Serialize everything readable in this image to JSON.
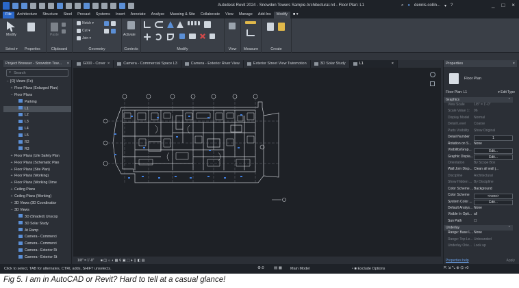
{
  "titlebar": {
    "title": "Autodesk Revit 2024 - Snowdon Towers Sample Architectural.rvt - Floor Plan: L1",
    "user": "dennis.collin...",
    "min": "_",
    "max": "□",
    "close": "×"
  },
  "menu": [
    "File",
    "Architecture",
    "Structure",
    "Steel",
    "Precast",
    "Systems",
    "Insert",
    "Annotate",
    "Analyze",
    "Massing & Site",
    "Collaborate",
    "View",
    "Manage",
    "Add-Ins",
    "Modify"
  ],
  "ribbon": {
    "modify_label": "Modify",
    "select_label": "Select ▾",
    "properties_label": "Properties",
    "clipboard_label": "Clipboard",
    "geometry_label": "Geometry",
    "controls_label": "Controls",
    "modify_group_label": "Modify",
    "view_label": "View",
    "measure_label": "Measure",
    "create_label": "Create",
    "paste_label": "Paste",
    "notch_label": "Notch ▾",
    "cut_label": "Cut ▾",
    "join_label": "Join ▾",
    "activate_label": "Activate"
  },
  "project_browser": {
    "title": "Project Browser - Snowdon Tow...",
    "close": "×",
    "search_placeholder": "Search",
    "items": [
      {
        "t": "−",
        "label": "[O] Views (Fe)",
        "indent": 0
      },
      {
        "t": "+",
        "label": "Floor Plans (Enlarged Plan)",
        "indent": 1
      },
      {
        "t": "−",
        "label": "Floor Plans",
        "indent": 1
      },
      {
        "t": "",
        "label": "Parking",
        "indent": 2,
        "icon": true
      },
      {
        "t": "",
        "label": "L1",
        "indent": 2,
        "icon": true,
        "sel": true
      },
      {
        "t": "",
        "label": "L2",
        "indent": 2,
        "icon": true
      },
      {
        "t": "",
        "label": "L3",
        "indent": 2,
        "icon": true
      },
      {
        "t": "",
        "label": "L4",
        "indent": 2,
        "icon": true
      },
      {
        "t": "",
        "label": "L5",
        "indent": 2,
        "icon": true
      },
      {
        "t": "",
        "label": "R2",
        "indent": 2,
        "icon": true
      },
      {
        "t": "",
        "label": "R3",
        "indent": 2,
        "icon": true
      },
      {
        "t": "+",
        "label": "Floor Plans (Life Safety Plan",
        "indent": 1
      },
      {
        "t": "+",
        "label": "Floor Plans (Schematic Plan",
        "indent": 1
      },
      {
        "t": "+",
        "label": "Floor Plans (Site Plan)",
        "indent": 1
      },
      {
        "t": "+",
        "label": "Floor Plans (Working)",
        "indent": 1
      },
      {
        "t": "+",
        "label": "Floor Plans (Working Dime",
        "indent": 1
      },
      {
        "t": "+",
        "label": "Ceiling Plans",
        "indent": 1
      },
      {
        "t": "+",
        "label": "Ceiling Plans (Working)",
        "indent": 1
      },
      {
        "t": "+",
        "label": "3D Views (3D Coordinatior",
        "indent": 1
      },
      {
        "t": "−",
        "label": "3D Views",
        "indent": 1
      },
      {
        "t": "",
        "label": "3D (Shaded) Unscop",
        "indent": 2,
        "icon": true
      },
      {
        "t": "",
        "label": "3D Solar Study",
        "indent": 2,
        "icon": true
      },
      {
        "t": "",
        "label": "At Ramp",
        "indent": 2,
        "icon": true
      },
      {
        "t": "",
        "label": "Camera - Commerci",
        "indent": 2,
        "icon": true
      },
      {
        "t": "",
        "label": "Camera - Commerci",
        "indent": 2,
        "icon": true
      },
      {
        "t": "",
        "label": "Camera - Exterior Ri",
        "indent": 2,
        "icon": true
      },
      {
        "t": "",
        "label": "Camera - Exterior St",
        "indent": 2,
        "icon": true
      }
    ]
  },
  "tabs": [
    "G000 - Cover",
    "Camera - Commercial Space L3",
    "Camera - Exterior River View",
    "Exterior Street View Twinmotion",
    "3D Solar Study",
    "L1"
  ],
  "view_control": {
    "scale": "1/8\" = 1'-0\""
  },
  "properties": {
    "title": "Properties",
    "close": "×",
    "type": "Floor Plan",
    "instance": "Floor Plan: L1",
    "edit_type": "Edit Type",
    "graphics_label": "Graphics",
    "underlay_label": "Underlay",
    "graphics": [
      {
        "k": "View Scale",
        "v": "1/8\" = 1'-0\"",
        "dim": true
      },
      {
        "k": "Scale Value  1:",
        "v": "96",
        "dim": true
      },
      {
        "k": "Display Model",
        "v": "Normal",
        "dim": true
      },
      {
        "k": "Detail Level",
        "v": "Coarse",
        "dim": true
      },
      {
        "k": "Parts Visibility",
        "v": "Show Original",
        "dim": true
      },
      {
        "k": "Detail Number",
        "v": "1",
        "box": true
      },
      {
        "k": "Rotation on S...",
        "v": "None"
      },
      {
        "k": "Visibility/Grap...",
        "v": "Edit...",
        "box": true
      },
      {
        "k": "Graphic Displa...",
        "v": "Edit...",
        "box": true
      },
      {
        "k": "Orientation",
        "v": "By Scope Box",
        "dim": true
      },
      {
        "k": "Wall Join Disp...",
        "v": "Clean all wall j..."
      },
      {
        "k": "Discipline",
        "v": "Architectural",
        "dim": true
      },
      {
        "k": "Show Hidden ...",
        "v": "By Discipline",
        "dim": true
      },
      {
        "k": "Color Scheme ...",
        "v": "Background"
      },
      {
        "k": "Color Scheme",
        "v": "<none>",
        "box": true
      },
      {
        "k": "System Color ...",
        "v": "Edit...",
        "box": true
      },
      {
        "k": "Default Analys...",
        "v": "None"
      },
      {
        "k": "Visible In Opti...",
        "v": "all"
      },
      {
        "k": "Sun Path",
        "v": "☐"
      }
    ],
    "underlay": [
      {
        "k": "Range: Base L...",
        "v": "None"
      },
      {
        "k": "Range: Top Le...",
        "v": "Unbounded",
        "dim": true
      },
      {
        "k": "Underlay Orie...",
        "v": "Look up",
        "dim": true
      }
    ],
    "help": "Properties help",
    "apply": "Apply"
  },
  "status": {
    "hint": "Click to select, TAB for alternates, CTRL adds, SHIFT unselects.",
    "count": ":0",
    "model": "Main Model",
    "exclude": "Exclude Options"
  },
  "caption": "Fig 5. I am in AutoCAD or Revit? Hard to tell at a casual glance!"
}
